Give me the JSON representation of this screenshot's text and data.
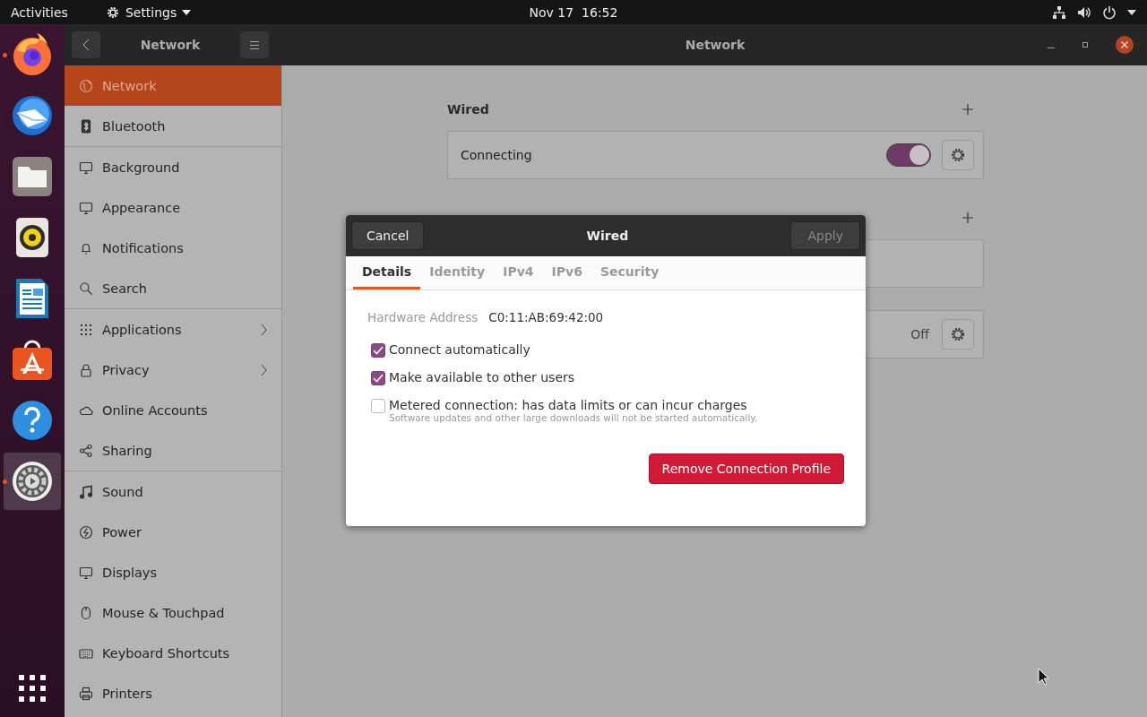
{
  "top_bar": {
    "activities": "Activities",
    "app_menu": "Settings",
    "clock": "Nov 17  16:52"
  },
  "dock": [
    {
      "kind": "firefox",
      "running": true,
      "selected": false
    },
    {
      "kind": "mail",
      "running": false,
      "selected": false
    },
    {
      "kind": "files",
      "running": false,
      "selected": false
    },
    {
      "kind": "music",
      "running": false,
      "selected": false
    },
    {
      "kind": "writer",
      "running": false,
      "selected": false
    },
    {
      "kind": "store",
      "running": false,
      "selected": false
    },
    {
      "kind": "help",
      "running": false,
      "selected": false
    },
    {
      "kind": "settings",
      "running": true,
      "selected": true
    }
  ],
  "header": {
    "sidebar_title": "Network",
    "title": "Network"
  },
  "sidebar": [
    {
      "kind": "globe",
      "label": "Network",
      "selected": true,
      "submenu": false,
      "separator_after": false
    },
    {
      "kind": "bluetooth",
      "label": "Bluetooth",
      "selected": false,
      "submenu": false,
      "separator_after": true
    },
    {
      "kind": "monitor",
      "label": "Background",
      "selected": false,
      "submenu": false,
      "separator_after": false
    },
    {
      "kind": "monitor",
      "label": "Appearance",
      "selected": false,
      "submenu": false,
      "separator_after": false
    },
    {
      "kind": "bell",
      "label": "Notifications",
      "selected": false,
      "submenu": false,
      "separator_after": false
    },
    {
      "kind": "search",
      "label": "Search",
      "selected": false,
      "submenu": false,
      "separator_after": true
    },
    {
      "kind": "grid",
      "label": "Applications",
      "selected": false,
      "submenu": true,
      "separator_after": false
    },
    {
      "kind": "lock",
      "label": "Privacy",
      "selected": false,
      "submenu": true,
      "separator_after": false
    },
    {
      "kind": "cloud",
      "label": "Online Accounts",
      "selected": false,
      "submenu": false,
      "separator_after": false
    },
    {
      "kind": "share",
      "label": "Sharing",
      "selected": false,
      "submenu": false,
      "separator_after": true
    },
    {
      "kind": "note",
      "label": "Sound",
      "selected": false,
      "submenu": false,
      "separator_after": false
    },
    {
      "kind": "power",
      "label": "Power",
      "selected": false,
      "submenu": false,
      "separator_after": false
    },
    {
      "kind": "monitor",
      "label": "Displays",
      "selected": false,
      "submenu": false,
      "separator_after": false
    },
    {
      "kind": "mouse",
      "label": "Mouse & Touchpad",
      "selected": false,
      "submenu": false,
      "separator_after": false
    },
    {
      "kind": "keyboard",
      "label": "Keyboard Shortcuts",
      "selected": false,
      "submenu": false,
      "separator_after": false
    },
    {
      "kind": "printer",
      "label": "Printers",
      "selected": false,
      "submenu": false,
      "separator_after": false
    }
  ],
  "wired": {
    "title": "Wired",
    "status": "Connecting",
    "on": true
  },
  "other_card": {
    "status": "Off"
  },
  "dialog": {
    "title": "Wired",
    "cancel": "Cancel",
    "apply": "Apply",
    "apply_disabled": true,
    "tabs": [
      {
        "label": "Details",
        "selected": true
      },
      {
        "label": "Identity",
        "selected": false
      },
      {
        "label": "IPv4",
        "selected": false
      },
      {
        "label": "IPv6",
        "selected": false
      },
      {
        "label": "Security",
        "selected": false
      }
    ],
    "hardware_label": "Hardware Address",
    "hardware_value": "C0:11:AB:69:42:00",
    "options": [
      {
        "label": "Connect automatically",
        "checked": true
      },
      {
        "label": "Make available to other users",
        "checked": true
      },
      {
        "label": "Metered connection: has data limits or can incur charges",
        "hint": "Software updates and other large downloads will not be started automatically.",
        "checked": false
      }
    ],
    "remove": "Remove Connection Profile"
  }
}
